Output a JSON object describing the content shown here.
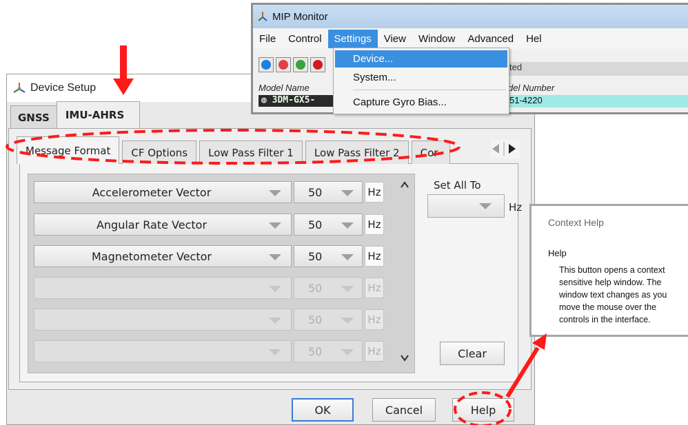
{
  "device_setup": {
    "title": "Device Setup",
    "outer_tabs": [
      "GNSS",
      "IMU-AHRS"
    ],
    "inner_tabs": [
      "Message Format",
      "CF Options",
      "Low Pass Filter 1",
      "Low Pass Filter 2",
      "Cor"
    ],
    "rows": [
      {
        "name": "Accelerometer Vector",
        "rate": "50",
        "unit": "Hz",
        "enabled": true
      },
      {
        "name": "Angular Rate Vector",
        "rate": "50",
        "unit": "Hz",
        "enabled": true
      },
      {
        "name": "Magnetometer Vector",
        "rate": "50",
        "unit": "Hz",
        "enabled": true
      },
      {
        "name": "",
        "rate": "50",
        "unit": "Hz",
        "enabled": false
      },
      {
        "name": "",
        "rate": "50",
        "unit": "Hz",
        "enabled": false
      },
      {
        "name": "",
        "rate": "50",
        "unit": "Hz",
        "enabled": false
      }
    ],
    "set_all_label": "Set All To",
    "set_all_unit": "Hz",
    "buttons": {
      "clear": "Clear",
      "ok": "OK",
      "cancel": "Cancel",
      "help": "Help"
    }
  },
  "mip_monitor": {
    "title": "MIP Monitor",
    "menu": [
      "File",
      "Control",
      "Settings",
      "View",
      "Window",
      "Advanced",
      "Hel"
    ],
    "settings_menu": [
      "Device...",
      "System...",
      "Capture Gyro Bias..."
    ],
    "model_name_header": "Model Name",
    "model_name_value": "3DM-GX5-",
    "model_number_header": "del Number",
    "model_number_value": "51-4220",
    "status_partial": "ted"
  },
  "context_help": {
    "title": "Context Help",
    "heading": "Help",
    "body": "This button opens a context sensitive help window.  The window text changes as you move the mouse over the controls in the interface."
  },
  "colors": {
    "annotation_red": "#ff1a1a",
    "menu_highlight": "#3b8fe0",
    "model_value_bg": "#9fe9e6"
  }
}
